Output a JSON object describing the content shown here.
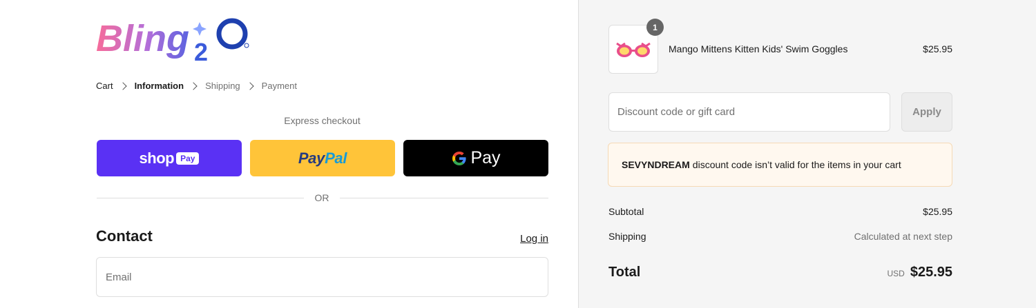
{
  "brand": {
    "logo_text": "Bling",
    "logo_mark": "2O"
  },
  "breadcrumb": {
    "items": [
      {
        "label": "Cart"
      },
      {
        "label": "Information"
      },
      {
        "label": "Shipping"
      },
      {
        "label": "Payment"
      }
    ]
  },
  "express": {
    "label": "Express checkout",
    "shop_pay_word": "shop",
    "shop_pay_badge": "Pay",
    "paypal_part1": "Pay",
    "paypal_part2": "Pal",
    "gpay_word": "Pay"
  },
  "divider": {
    "label": "OR"
  },
  "contact": {
    "title": "Contact",
    "login_label": "Log in",
    "email_placeholder": "Email"
  },
  "cart": {
    "item": {
      "quantity": "1",
      "name": "Mango Mittens Kitten Kids' Swim Goggles",
      "price": "$25.95"
    },
    "discount": {
      "placeholder": "Discount code or gift card",
      "apply_label": "Apply"
    },
    "notice": {
      "code": "SEVYNDREAM",
      "message": "discount code isn’t valid for the items in your cart"
    },
    "subtotal": {
      "label": "Subtotal",
      "value": "$25.95"
    },
    "shipping": {
      "label": "Shipping",
      "value": "Calculated at next step"
    },
    "total": {
      "label": "Total",
      "currency": "USD",
      "value": "$25.95"
    }
  },
  "colors": {
    "shop_pay": "#5a31f4",
    "paypal": "#ffc439",
    "gpay": "#000000",
    "notice_bg": "#fff8ef",
    "logo_gradient_start": "#f06292",
    "logo_gradient_end": "#3f51b5"
  }
}
